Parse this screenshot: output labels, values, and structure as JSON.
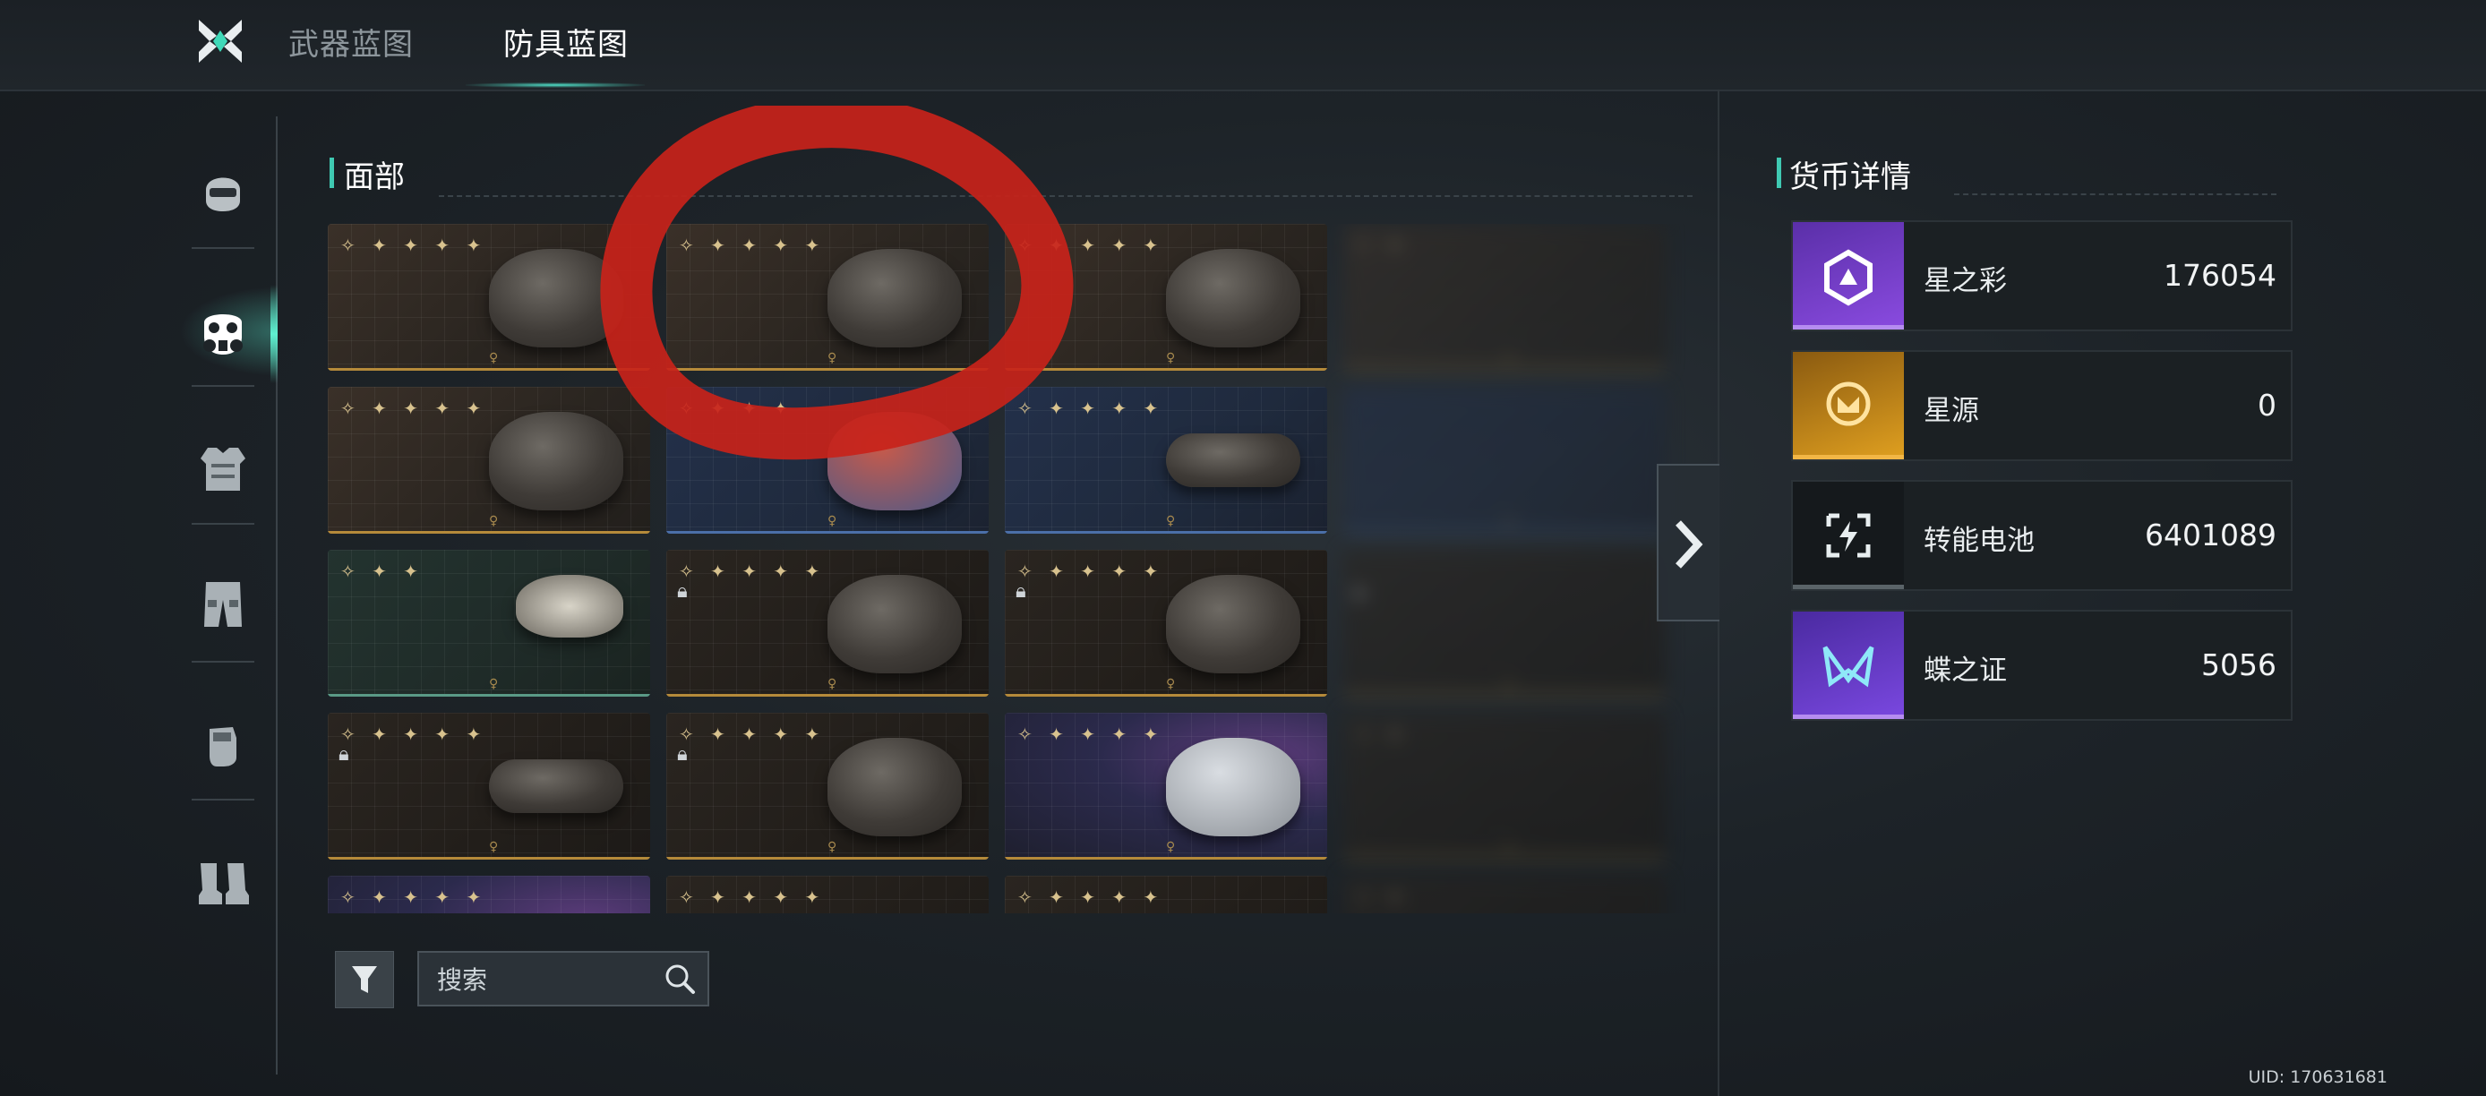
{
  "topnav": {
    "tabs": [
      {
        "label": "武器蓝图",
        "active": false
      },
      {
        "label": "防具蓝图",
        "active": true
      }
    ]
  },
  "sidebar": {
    "categories": [
      {
        "icon": "helmet-icon",
        "active": false
      },
      {
        "icon": "gas-mask-icon",
        "active": true
      },
      {
        "icon": "body-armor-icon",
        "active": false
      },
      {
        "icon": "pants-icon",
        "active": false
      },
      {
        "icon": "glove-icon",
        "active": false
      },
      {
        "icon": "boots-icon",
        "active": false
      }
    ]
  },
  "section": {
    "title": "面部"
  },
  "grid": {
    "rows": [
      [
        {
          "stars": "✧ ✦ ✦ ✦ ✦",
          "theme": "gold",
          "locked": false,
          "item": "skull-mask"
        },
        {
          "stars": "✧ ✦ ✦ ✦ ✦",
          "theme": "gold",
          "locked": false,
          "item": "respirator"
        },
        {
          "stars": "✧ ✦ ✦ ✦ ✦",
          "theme": "gold",
          "locked": false,
          "item": "leather-mask"
        },
        {
          "stars": "✧ ✦",
          "theme": "gold",
          "locked": false,
          "item": "blurred"
        }
      ],
      [
        {
          "stars": "✧ ✦ ✦ ✦ ✦",
          "theme": "gold",
          "locked": false,
          "item": "gas-mask"
        },
        {
          "stars": "✧ ✦ ✦ ✦",
          "theme": "blue",
          "locked": false,
          "item": "filter-respirator"
        },
        {
          "stars": "✧ ✦ ✦ ✦ ✦",
          "theme": "blue",
          "locked": false,
          "item": "goggles"
        },
        {
          "stars": "",
          "theme": "blue",
          "locked": false,
          "item": "blurred"
        }
      ],
      [
        {
          "stars": "✧ ✦ ✦",
          "theme": "green",
          "locked": false,
          "item": "nose-clip"
        },
        {
          "stars": "✧ ✦ ✦ ✦ ✦",
          "theme": "dark",
          "locked": true,
          "item": "balaclava"
        },
        {
          "stars": "✧ ✦ ✦ ✦ ✦",
          "theme": "dark",
          "locked": true,
          "item": "face-mask"
        },
        {
          "stars": "",
          "theme": "dark",
          "locked": true,
          "item": "blurred"
        }
      ],
      [
        {
          "stars": "✧ ✦ ✦ ✦ ✦",
          "theme": "dark",
          "locked": true,
          "item": "goggles-black"
        },
        {
          "stars": "✧ ✦ ✦ ✦ ✦",
          "theme": "dark",
          "locked": true,
          "item": "half-mask"
        },
        {
          "stars": "✧ ✦ ✦ ✦ ✦",
          "theme": "galaxy",
          "locked": false,
          "item": "cloth-mask"
        },
        {
          "stars": "✧ ✦",
          "theme": "dark",
          "locked": false,
          "item": "blurred"
        }
      ],
      [
        {
          "stars": "✧ ✦ ✦ ✦ ✦",
          "theme": "galaxy",
          "locked": true,
          "item": "partial"
        },
        {
          "stars": "✧ ✦ ✦ ✦ ✦",
          "theme": "dark",
          "locked": true,
          "item": "partial"
        },
        {
          "stars": "✧ ✦ ✦ ✦ ✦",
          "theme": "dark",
          "locked": false,
          "item": "partial"
        },
        {
          "stars": "✧ ✦",
          "theme": "dark",
          "locked": false,
          "item": "blurred"
        }
      ]
    ]
  },
  "search": {
    "placeholder": "搜索"
  },
  "currency": {
    "title": "货币详情",
    "items": [
      {
        "name": "星之彩",
        "value": "176054",
        "icon": "purple-triangle-emblem-icon",
        "color": "#7b3fd0"
      },
      {
        "name": "星源",
        "value": "0",
        "icon": "gold-moth-coin-icon",
        "color": "#d6901c"
      },
      {
        "name": "转能电池",
        "value": "6401089",
        "icon": "battery-bolt-icon",
        "color": "#1a1f22"
      },
      {
        "name": "蝶之证",
        "value": "5056",
        "icon": "butterfly-m-icon",
        "color": "#6b3fd0"
      }
    ]
  },
  "footer": {
    "uid": "UID: 170631681"
  },
  "annotation": {
    "color": "#c8231a"
  }
}
